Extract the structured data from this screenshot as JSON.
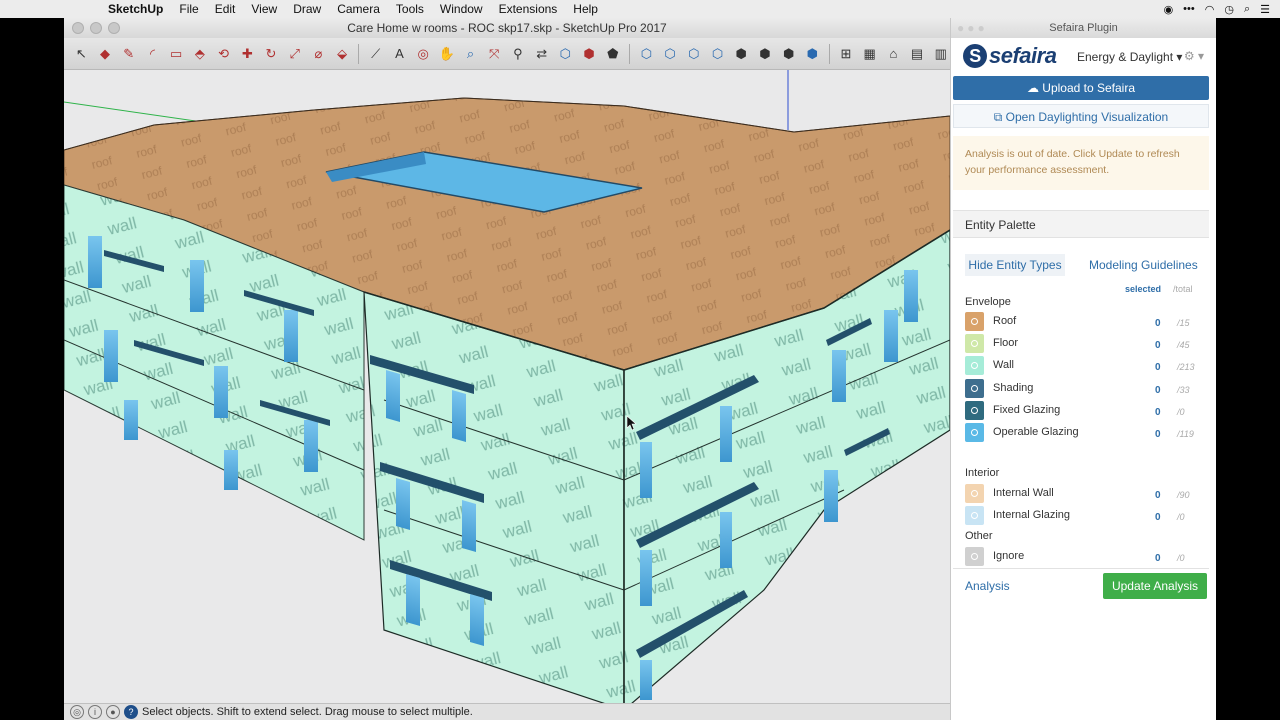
{
  "menubar": {
    "app": "SketchUp",
    "items": [
      "File",
      "Edit",
      "View",
      "Draw",
      "Camera",
      "Tools",
      "Window",
      "Extensions",
      "Help"
    ]
  },
  "window": {
    "title": "Care Home w rooms - ROC skp17.skp - SketchUp Pro 2017"
  },
  "viewport": {
    "wall_label": "wall",
    "roof_label": "roof"
  },
  "status": {
    "text": "Select objects. Shift to extend select. Drag mouse to select multiple."
  },
  "plugin": {
    "title": "Sefaira Plugin",
    "logo_text": "sefaira",
    "mode": "Energy & Daylight",
    "upload_label": "Upload to Sefaira",
    "open_label": "Open Daylighting Visualization",
    "alert": "Analysis is out of date. Click Update to refresh your performance assessment.",
    "palette_title": "Entity Palette",
    "hide_types_label": "Hide Entity Types",
    "guidelines_label": "Modeling Guidelines",
    "col_selected": "selected",
    "col_total": "/total",
    "groups": {
      "envelope": "Envelope",
      "interior": "Interior",
      "other": "Other"
    },
    "entities": [
      {
        "name": "Roof",
        "selected": "0",
        "total": "/15",
        "color": "#d9a26a"
      },
      {
        "name": "Floor",
        "selected": "0",
        "total": "/45",
        "color": "#cfe8a8"
      },
      {
        "name": "Wall",
        "selected": "0",
        "total": "/213",
        "color": "#a6ecd8"
      },
      {
        "name": "Shading",
        "selected": "0",
        "total": "/33",
        "color": "#3e6e8e"
      },
      {
        "name": "Fixed Glazing",
        "selected": "0",
        "total": "/0",
        "color": "#2f6b7f"
      },
      {
        "name": "Operable Glazing",
        "selected": "0",
        "total": "/119",
        "color": "#5ab9e6"
      },
      {
        "name": "Internal Wall",
        "selected": "0",
        "total": "/90",
        "color": "#f3d4b0"
      },
      {
        "name": "Internal Glazing",
        "selected": "0",
        "total": "/0",
        "color": "#c8e4f4"
      },
      {
        "name": "Ignore",
        "selected": "0",
        "total": "/0",
        "color": "#d0d0d0"
      }
    ],
    "analysis_link": "Analysis",
    "update_label": "Update Analysis"
  }
}
